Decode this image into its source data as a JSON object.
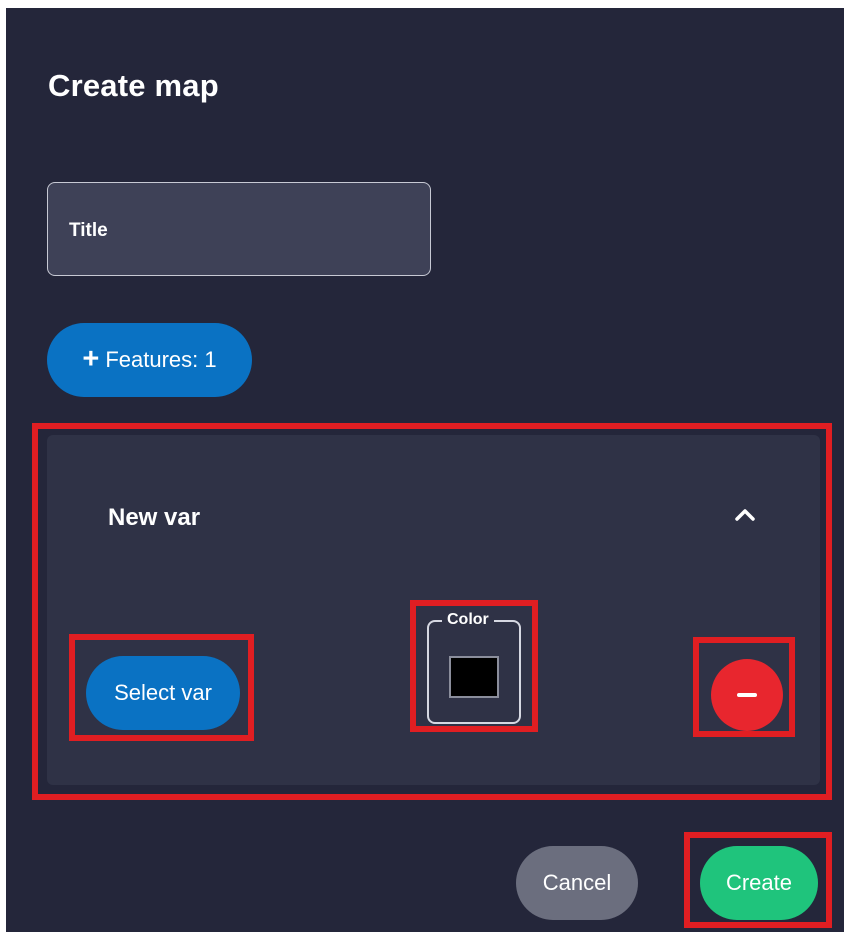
{
  "dialog": {
    "title": "Create map"
  },
  "title_field": {
    "label": "Title",
    "value": ""
  },
  "features_button": {
    "label": "Features: 1"
  },
  "feature_card": {
    "name": "New var",
    "expanded": true,
    "select_var_label": "Select var",
    "color": {
      "label": "Color",
      "value": "#000000"
    }
  },
  "actions": {
    "cancel_label": "Cancel",
    "create_label": "Create"
  },
  "colors": {
    "background": "#24263a",
    "card": "#2f3246",
    "primary": "#0a72c3",
    "danger": "#e8262e",
    "success": "#1fc47c",
    "neutral": "#6b6e7e",
    "highlight": "#e01e22"
  },
  "icons": {
    "add": "plus-icon",
    "collapse": "chevron-up-icon",
    "remove": "minus-icon"
  }
}
